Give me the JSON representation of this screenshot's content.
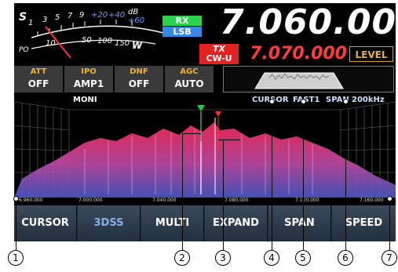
{
  "meter": {
    "scale_s": [
      "S",
      "1",
      "3",
      "5",
      "7",
      "9",
      "+20",
      "+40",
      "dB",
      "+60"
    ],
    "scale_po": [
      "PO",
      "10",
      "50",
      "100",
      "150",
      "W"
    ]
  },
  "mode": {
    "rx": "RX",
    "sideband": "LSB",
    "tx": "TX",
    "tx_mode": "CW-U"
  },
  "frequency": {
    "main": "7.060.000",
    "sub": "7.070.000"
  },
  "level_button": "LEVEL",
  "functions": [
    {
      "name": "ATT",
      "value": "OFF"
    },
    {
      "name": "IPO",
      "value": "AMP1"
    },
    {
      "name": "DNF",
      "value": "OFF"
    },
    {
      "name": "AGC",
      "value": "AUTO"
    }
  ],
  "spectrum": {
    "moni_label": "MONI",
    "cursor_label": "CURSOR",
    "speed_label": "FAST1",
    "span_label": "SPAN",
    "span_value": "200kHz",
    "axis_ticks": [
      "6.960.000",
      "7.000.000",
      "7.040.000",
      "7.080.000",
      "7.120.000",
      "7.160.000"
    ]
  },
  "softkeys": [
    {
      "label": "CURSOR",
      "active": false
    },
    {
      "label": "3DSS",
      "active": true
    },
    {
      "label": "MULTI",
      "active": false
    },
    {
      "label": "EXPAND",
      "active": false
    },
    {
      "label": "SPAN",
      "active": false
    },
    {
      "label": "SPEED",
      "active": false
    }
  ],
  "callouts": [
    "1",
    "2",
    "3",
    "4",
    "5",
    "6",
    "7"
  ],
  "colors": {
    "accent": "#f0b030",
    "rx": "#2bd34a",
    "lsb": "#3a88e6",
    "tx": "#e42222",
    "sub_freq": "#ff3b3b"
  }
}
